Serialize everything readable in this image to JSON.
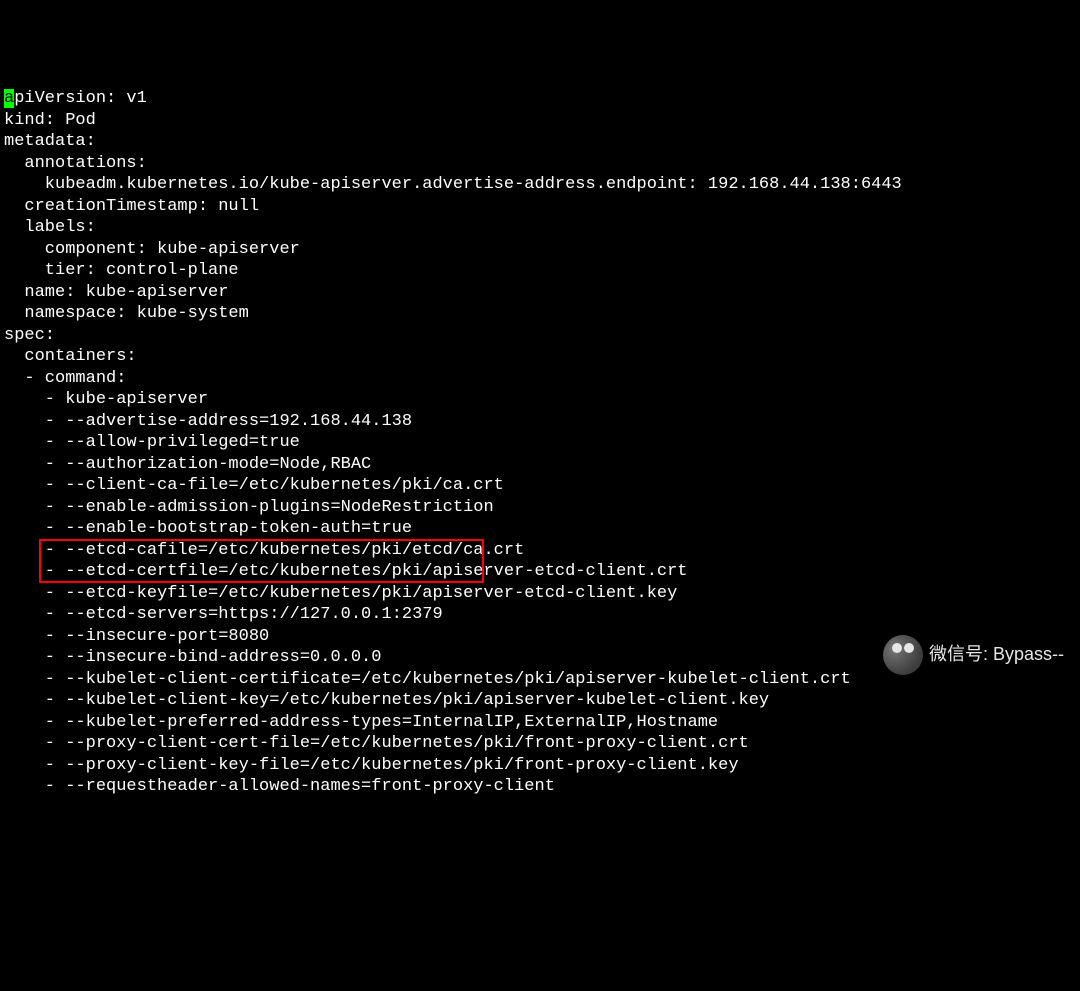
{
  "lines": [
    "apiVersion: v1",
    "kind: Pod",
    "metadata:",
    "  annotations:",
    "    kubeadm.kubernetes.io/kube-apiserver.advertise-address.endpoint: 192.168.44.138:6443",
    "  creationTimestamp: null",
    "  labels:",
    "    component: kube-apiserver",
    "    tier: control-plane",
    "  name: kube-apiserver",
    "  namespace: kube-system",
    "spec:",
    "  containers:",
    "  - command:",
    "    - kube-apiserver",
    "    - --advertise-address=192.168.44.138",
    "    - --allow-privileged=true",
    "    - --authorization-mode=Node,RBAC",
    "    - --client-ca-file=/etc/kubernetes/pki/ca.crt",
    "    - --enable-admission-plugins=NodeRestriction",
    "    - --enable-bootstrap-token-auth=true",
    "    - --etcd-cafile=/etc/kubernetes/pki/etcd/ca.crt",
    "    - --etcd-certfile=/etc/kubernetes/pki/apiserver-etcd-client.crt",
    "    - --etcd-keyfile=/etc/kubernetes/pki/apiserver-etcd-client.key",
    "    - --etcd-servers=https://127.0.0.1:2379",
    "    - --insecure-port=8080",
    "    - --insecure-bind-address=0.0.0.0",
    "    - --kubelet-client-certificate=/etc/kubernetes/pki/apiserver-kubelet-client.crt",
    "    - --kubelet-client-key=/etc/kubernetes/pki/apiserver-kubelet-client.key",
    "    - --kubelet-preferred-address-types=InternalIP,ExternalIP,Hostname",
    "    - --proxy-client-cert-file=/etc/kubernetes/pki/front-proxy-client.crt",
    "    - --proxy-client-key-file=/etc/kubernetes/pki/front-proxy-client.key",
    "    - --requestheader-allowed-names=front-proxy-client"
  ],
  "cursor_line": 0,
  "cursor_col": 0,
  "watermark": "微信号: Bypass--"
}
